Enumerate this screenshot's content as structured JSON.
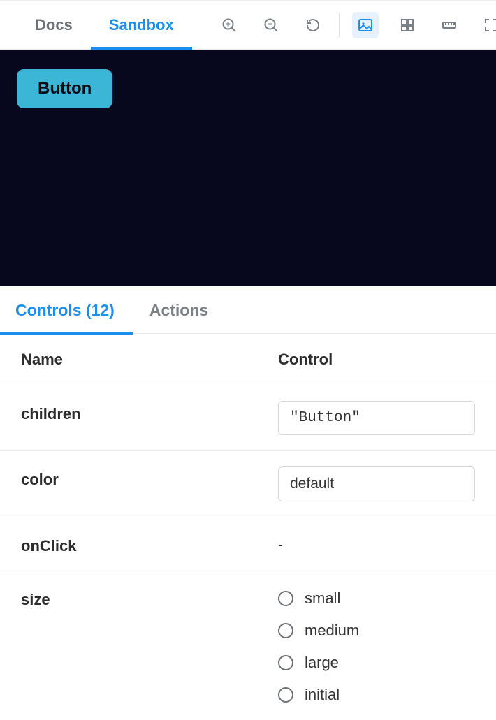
{
  "top": {
    "tabs": [
      {
        "label": "Docs",
        "active": false
      },
      {
        "label": "Sandbox",
        "active": true
      }
    ],
    "icons": [
      "zoom-in-icon",
      "zoom-out-icon",
      "reset-zoom-icon",
      "image-view-icon",
      "grid-view-icon",
      "ruler-icon",
      "fullscreen-icon"
    ]
  },
  "preview": {
    "button_label": "Button",
    "bg": "#07071d",
    "button_bg": "#3bb6d6"
  },
  "panel": {
    "tabs": {
      "controls_label": "Controls (12)",
      "actions_label": "Actions",
      "controls_count": 12
    },
    "header": {
      "name": "Name",
      "control": "Control"
    },
    "rows": {
      "children": {
        "prop": "children",
        "value": "\"Button\""
      },
      "color": {
        "prop": "color",
        "value": "default"
      },
      "onClick": {
        "prop": "onClick",
        "value": "-"
      },
      "size": {
        "prop": "size",
        "options": [
          "small",
          "medium",
          "large",
          "initial"
        ],
        "selected": null
      }
    }
  }
}
